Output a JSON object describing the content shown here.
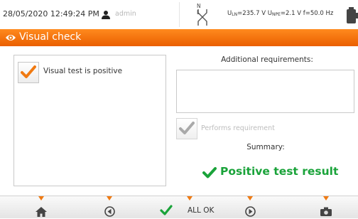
{
  "status_bar": {
    "datetime": "28/05/2020 12:49:24 PM",
    "user": "admin",
    "user_icon": "user-icon",
    "network_icon": "n-l-connection-icon",
    "nl_label": "N L",
    "measurements": {
      "uln_symbol": "U",
      "uln_sub": "LN",
      "uln_value": "=235.7 V",
      "upe_symbol": "U",
      "upe_sub": "NPE",
      "upe_value": "=2.1 V",
      "freq": "f=50.0 Hz"
    },
    "battery_icon": "battery-icon"
  },
  "title_bar": {
    "icon": "eye-icon",
    "title": "Visual check"
  },
  "visual_check": {
    "checked": true,
    "label": "Visual test is positive"
  },
  "requirements": {
    "heading": "Additional requirements:",
    "value": "",
    "performs_label": "Performs requirement",
    "performs_checked": true,
    "performs_enabled": false
  },
  "summary": {
    "label": "Summary:",
    "result": "Positive test result",
    "result_icon": "checkmark-icon"
  },
  "bottom_bar": {
    "home_icon": "home-icon",
    "prev_icon": "arrow-left-circle-icon",
    "allok_icon": "checkmark-icon",
    "allok_label": "ALL OK",
    "next_icon": "arrow-right-circle-icon",
    "camera_icon": "camera-icon"
  },
  "colors": {
    "accent": "#f07a12",
    "positive": "#1aa33a",
    "check_orange": "#f07a12",
    "disabled": "#bdbdbd"
  }
}
